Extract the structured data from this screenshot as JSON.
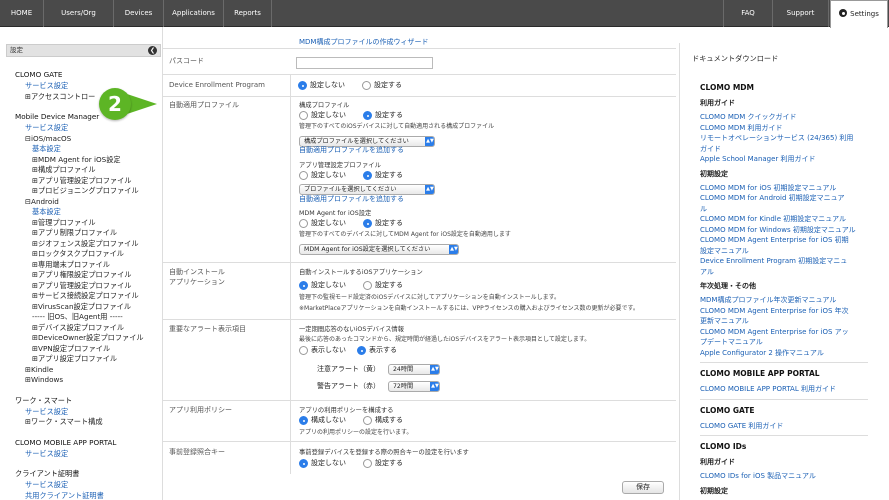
{
  "nav": {
    "left": [
      "HOME",
      "Users/Org",
      "Devices",
      "Applications",
      "Reports"
    ],
    "right": [
      "FAQ",
      "Support"
    ],
    "settings": "Settings"
  },
  "sidebar": {
    "header": "設定",
    "items": [
      {
        "text": "CLOMO GATE",
        "kind": "h"
      },
      {
        "text": "サービス設定",
        "kind": "l"
      },
      {
        "text": "⊞アクセスコントロー",
        "kind": "t"
      },
      {
        "text": "Mobile Device Manager",
        "kind": "h"
      },
      {
        "text": "サービス設定",
        "kind": "l"
      },
      {
        "text": "⊟iOS/macOS",
        "kind": "t"
      },
      {
        "text": "基本設定",
        "kind": "l"
      },
      {
        "text": "⊞MDM Agent for iOS設定",
        "kind": "t"
      },
      {
        "text": "⊞構成プロファイル",
        "kind": "t"
      },
      {
        "text": "⊞アプリ管理設定プロファイル",
        "kind": "t"
      },
      {
        "text": "⊞プロビジョニングプロファイル",
        "kind": "t"
      },
      {
        "text": "⊟Android",
        "kind": "t"
      },
      {
        "text": "基本設定",
        "kind": "l"
      },
      {
        "text": "⊞管理プロファイル",
        "kind": "t"
      },
      {
        "text": "⊞アプリ制限プロファイル",
        "kind": "t"
      },
      {
        "text": "⊞ジオフェンス設定プロファイル",
        "kind": "t"
      },
      {
        "text": "⊞ロックタスクプロファイル",
        "kind": "t"
      },
      {
        "text": "⊞専用端末プロファイル",
        "kind": "t"
      },
      {
        "text": "⊞アプリ権限設定プロファイル",
        "kind": "t"
      },
      {
        "text": "⊞アプリ管理設定プロファイル",
        "kind": "t"
      },
      {
        "text": "⊞サービス接続設定プロファイル",
        "kind": "t"
      },
      {
        "text": "⊞VirusScan設定プロファイル",
        "kind": "t"
      },
      {
        "text": "----- 旧OS、旧Agent用 -----",
        "kind": "t"
      },
      {
        "text": "⊞デバイス設定プロファイル",
        "kind": "t"
      },
      {
        "text": "⊞DeviceOwner設定プロファイル",
        "kind": "t"
      },
      {
        "text": "⊞VPN設定プロファイル",
        "kind": "t"
      },
      {
        "text": "⊞アプリ設定プロファイル",
        "kind": "t"
      },
      {
        "text": "⊞Kindle",
        "kind": "t"
      },
      {
        "text": "⊞Windows",
        "kind": "t"
      },
      {
        "text": "ワーク・スマート",
        "kind": "h"
      },
      {
        "text": "サービス設定",
        "kind": "l"
      },
      {
        "text": "⊞ワーク・スマート構成",
        "kind": "t"
      },
      {
        "text": "CLOMO MOBILE APP PORTAL",
        "kind": "h"
      },
      {
        "text": "サービス設定",
        "kind": "l"
      },
      {
        "text": "クライアント証明書",
        "kind": "h"
      },
      {
        "text": "サービス設定",
        "kind": "l"
      },
      {
        "text": "共用クライアント証明書",
        "kind": "l"
      }
    ]
  },
  "annotation": {
    "number": "2"
  },
  "main": {
    "top_link": "MDM構成プロファイルの作成ウィザード",
    "passcode_label": "パスコード",
    "dep_label": "Device Enrollment Program",
    "dep_options": [
      "設定しない",
      "設定する"
    ],
    "auto_profile_label": "自動適用プロファイル",
    "config_profile_title": "構成プロファイル",
    "config_options": [
      "設定しない",
      "設定する"
    ],
    "config_desc": "管理下のすべてのiOSデバイスに対して自動適用される構成プロファイル",
    "config_select": "構成プロファイルを選択してください",
    "config_add": "自動適用プロファイルを追加する",
    "appmgmt_title": "アプリ管理設定プロファイル",
    "appmgmt_options": [
      "設定しない",
      "設定する"
    ],
    "appmgmt_select": "プロファイルを選択してください",
    "appmgmt_add": "自動適用プロファイルを追加する",
    "agent_title": "MDM Agent for iOS設定",
    "agent_options": [
      "設定しない",
      "設定する"
    ],
    "agent_desc": "管理下のすべてのデバイスに対してMDM Agent for iOS設定を自動適用します",
    "agent_select": "MDM Agent for iOS設定を選択してください",
    "auto_install_label": [
      "自動インストール",
      "アプリケーション"
    ],
    "auto_install_title": "自動インストールするiOSアプリケーション",
    "auto_install_options": [
      "設定しない",
      "設定する"
    ],
    "auto_install_desc1": "管理下の監視モード設定済のiOSデバイスに対してアプリケーションを自動インストールします。",
    "auto_install_desc2": "※MarketPlaceアプリケーションを自動インストールするには、VPPライセンスの購入およびライセンス数の更新が必要です。",
    "alert_label": "重要なアラート表示項目",
    "alert_title": "一定期間応答のないiOSデバイス情報",
    "alert_desc": "最後に応答のあったコマンドから、規定時間が経過したiOSデバイスをアラート表示項目として設定します。",
    "alert_options": [
      "表示しない",
      "表示する"
    ],
    "alert_yellow_label": "注意アラート（黄）",
    "alert_yellow_value": "24時間",
    "alert_red_label": "警告アラート（赤）",
    "alert_red_value": "72時間",
    "policy_label": "アプリ利用ポリシー",
    "policy_title": "アプリの利用ポリシーを構成する",
    "policy_options": [
      "構成しない",
      "構成する"
    ],
    "policy_desc": "アプリの利用ポリシーの設定を行います。",
    "prereg_label": "事前登録照合キー",
    "prereg_title": "事前登録デバイスを登録する際の照合キーの設定を行います",
    "prereg_options": [
      "設定しない",
      "設定する"
    ],
    "save_button": "保存"
  },
  "right": {
    "title": "ドキュメントダウンロード",
    "items": [
      {
        "text": "CLOMO MDM",
        "kind": "sec"
      },
      {
        "text": "利用ガイド",
        "kind": "sub"
      },
      {
        "text": "CLOMO MDM クイックガイド",
        "kind": "l"
      },
      {
        "text": "CLOMO MDM 利用ガイド",
        "kind": "l"
      },
      {
        "text": "リモートオペレーションサービス (24/365) 利用",
        "kind": "l"
      },
      {
        "text": "ガイド",
        "kind": "l"
      },
      {
        "text": "Apple School Manager 利用ガイド",
        "kind": "l"
      },
      {
        "text": "初期設定",
        "kind": "sub"
      },
      {
        "text": "CLOMO MDM for iOS 初期設定マニュアル",
        "kind": "l"
      },
      {
        "text": "CLOMO MDM for Android 初期設定マニュア",
        "kind": "l"
      },
      {
        "text": "ル",
        "kind": "l"
      },
      {
        "text": "CLOMO MDM for Kindle 初期設定マニュアル",
        "kind": "l"
      },
      {
        "text": "CLOMO MDM for Windows 初期設定マニュアル",
        "kind": "l"
      },
      {
        "text": "CLOMO MDM Agent Enterprise for iOS 初期",
        "kind": "l"
      },
      {
        "text": "設定マニュアル",
        "kind": "l"
      },
      {
        "text": "Device Enrollment Program 初期設定マニュ",
        "kind": "l"
      },
      {
        "text": "アル",
        "kind": "l"
      },
      {
        "text": "年次処理・その他",
        "kind": "sub"
      },
      {
        "text": "MDM構成プロファイル年次更新マニュアル",
        "kind": "l"
      },
      {
        "text": "CLOMO MDM Agent Enterprise for iOS 年次",
        "kind": "l"
      },
      {
        "text": "更新マニュアル",
        "kind": "l"
      },
      {
        "text": "CLOMO MDM Agent Enterprise for iOS アッ",
        "kind": "l"
      },
      {
        "text": "プデートマニュアル",
        "kind": "l"
      },
      {
        "text": "Apple Configurator 2 操作マニュアル",
        "kind": "l"
      },
      {
        "text": "CLOMO MOBILE APP PORTAL",
        "kind": "sec"
      },
      {
        "text": "CLOMO MOBILE APP PORTAL 利用ガイド",
        "kind": "l"
      },
      {
        "text": "CLOMO GATE",
        "kind": "sec"
      },
      {
        "text": "CLOMO GATE 利用ガイド",
        "kind": "l"
      },
      {
        "text": "CLOMO IDs",
        "kind": "sec"
      },
      {
        "text": "利用ガイド",
        "kind": "sub"
      },
      {
        "text": "CLOMO IDs for iOS 製品マニュアル",
        "kind": "l"
      },
      {
        "text": "初期設定",
        "kind": "sub"
      },
      {
        "text": "CLOMO IDs for iOS 初期設定マニュアル",
        "kind": "l"
      }
    ]
  }
}
